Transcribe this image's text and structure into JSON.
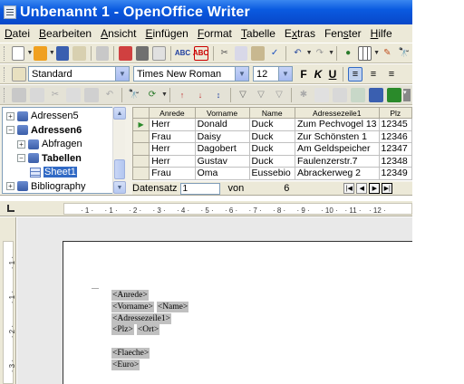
{
  "window": {
    "title": "Unbenannt 1 - OpenOffice Writer"
  },
  "menu": [
    {
      "label": "Datei",
      "u": "D",
      "rest": "atei"
    },
    {
      "label": "Bearbeiten",
      "u": "B",
      "rest": "earbeiten"
    },
    {
      "label": "Ansicht",
      "u": "A",
      "rest": "nsicht"
    },
    {
      "label": "Einfügen",
      "u": "E",
      "rest": "infügen"
    },
    {
      "label": "Format",
      "u": "F",
      "rest": "ormat"
    },
    {
      "label": "Tabelle",
      "u": "T",
      "rest": "abelle"
    },
    {
      "label": "Extras",
      "pre": "E",
      "u": "x",
      "rest": "tras"
    },
    {
      "label": "Fenster",
      "pre": "Fen",
      "u": "s",
      "rest": "ter"
    },
    {
      "label": "Hilfe",
      "u": "H",
      "rest": "ilfe"
    }
  ],
  "formatting": {
    "style": "Standard",
    "font": "Times New Roman",
    "size": "12",
    "bold_label": "F",
    "italic_label": "K",
    "underline_label": "U"
  },
  "datasource_tree": {
    "items": [
      {
        "label": "Adressen5",
        "expander": "+",
        "kind": "db"
      },
      {
        "label": "Adressen6",
        "expander": "−",
        "kind": "db"
      },
      {
        "label": "Abfragen",
        "expander": "+",
        "kind": "folder"
      },
      {
        "label": "Tabellen",
        "expander": "−",
        "kind": "folder"
      },
      {
        "label": "Sheet1",
        "expander": "",
        "kind": "table"
      },
      {
        "label": "Bibliography",
        "expander": "+",
        "kind": "db"
      }
    ]
  },
  "grid": {
    "columns": [
      "Anrede",
      "Vorname",
      "Name",
      "Adressezeile1",
      "Plz"
    ],
    "rows": [
      [
        "Herr",
        "Donald",
        "Duck",
        "Zum Pechvogel 13",
        "12345"
      ],
      [
        "Frau",
        "Daisy",
        "Duck",
        "Zur Schönsten 1",
        "12346"
      ],
      [
        "Herr",
        "Dagobert",
        "Duck",
        "Am Geldspeicher",
        "12347"
      ],
      [
        "Herr",
        "Gustav",
        "Duck",
        "Faulenzerstr.7",
        "12348"
      ],
      [
        "Frau",
        "Oma",
        "Eussebio",
        "Abrackerweg 2",
        "12349"
      ]
    ],
    "current_row_marker": "▶"
  },
  "navigator": {
    "label": "Datensatz",
    "record": "1",
    "of_label": "von",
    "total": "6"
  },
  "ruler": {
    "labels": [
      "1",
      "1",
      "2",
      "3",
      "4",
      "5",
      "6",
      "7",
      "8",
      "9",
      "10",
      "11",
      "12"
    ]
  },
  "vruler": {
    "labels": [
      "1",
      "1",
      "2",
      "3"
    ]
  },
  "document": {
    "lines": [
      [
        "<Anrede>"
      ],
      [
        "<Vorname>",
        "<Name>"
      ],
      [
        "<Adressezeile1>"
      ],
      [
        "<Plz>",
        "<Ort>"
      ],
      [],
      [
        "<Flaeche>"
      ],
      [
        "<Euro>"
      ]
    ]
  }
}
